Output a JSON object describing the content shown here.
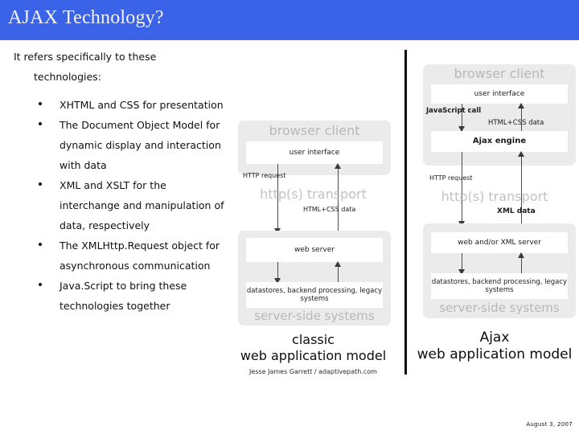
{
  "slide": {
    "title": "AJAX Technology?",
    "date_stamp": "August 3, 2007"
  },
  "content": {
    "lead_line1": "It refers specifically to these",
    "lead_line2": "technologies:",
    "bullets": [
      "XHTML and CSS for presentation",
      "The Document Object Model for dynamic display and interaction with data",
      "XML and XSLT for the interchange and manipulation of data, respectively",
      "The XMLHttp.Request object for asynchronous communication",
      "Java.Script to bring these technologies together"
    ]
  },
  "classic_diagram": {
    "browser_zone_label": "browser client",
    "user_interface_box": "user interface",
    "request_label": "HTTP request",
    "transport_label": "http(s) transport",
    "response_label": "HTML+CSS data",
    "web_server_box": "web server",
    "datastore_box": "datastores, backend processing, legacy systems",
    "server_zone_label": "server-side systems",
    "model_title_line1": "classic",
    "model_title_line2": "web application model",
    "credit": "Jesse James Garrett / adaptivepath.com"
  },
  "ajax_diagram": {
    "browser_zone_label": "browser client",
    "user_interface_box": "user interface",
    "js_call_label": "JavaScript call",
    "html_css_label": "HTML+CSS data",
    "ajax_engine_box": "Ajax engine",
    "request_label": "HTTP request",
    "transport_label": "http(s) transport",
    "xml_data_label": "XML data",
    "web_server_box": "web and/or XML server",
    "datastore_box": "datastores, backend processing, legacy systems",
    "server_zone_label": "server-side systems",
    "model_title_line1": "Ajax",
    "model_title_line2": "web application model"
  },
  "colors": {
    "title_bar": "#3b63e8",
    "zone_gray": "#ebebeb",
    "zone_label_gray": "#b8b8b8"
  }
}
